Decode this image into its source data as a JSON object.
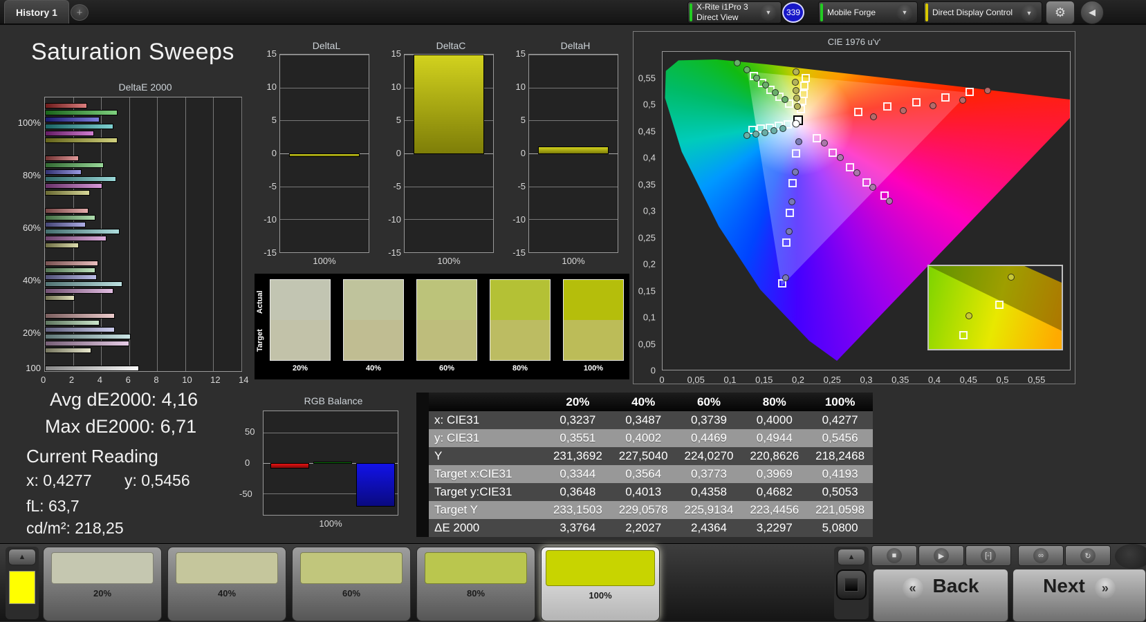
{
  "top_bar": {
    "tab": "History 1",
    "add_tab": "+",
    "meter": {
      "line1": "X-Rite i1Pro 3",
      "line2": "Direct View",
      "badge": "339",
      "status_color": "#22cc22"
    },
    "source": {
      "label": "Mobile Forge",
      "status_color": "#22cc22"
    },
    "workflow": {
      "label": "Direct Display Control",
      "status_color": "#d8c800"
    },
    "gear_icon": "⚙",
    "collapse_icon": "◀",
    "chevron_down": "▼"
  },
  "title": "Saturation Sweeps",
  "readings": {
    "avg": "Avg dE2000: 4,16",
    "max": "Max dE2000: 6,71",
    "heading": "Current Reading",
    "x": "x: 0,4277",
    "y": "y: 0,5456",
    "fl": "fL: 63,7",
    "cdm2": "cd/m²: 218,25"
  },
  "table": {
    "columns": [
      "20%",
      "40%",
      "60%",
      "80%",
      "100%"
    ],
    "rows": [
      {
        "label": "x: CIE31",
        "values": [
          "0,3237",
          "0,3487",
          "0,3739",
          "0,4000",
          "0,4277"
        ]
      },
      {
        "label": "y: CIE31",
        "values": [
          "0,3551",
          "0,4002",
          "0,4469",
          "0,4944",
          "0,5456"
        ]
      },
      {
        "label": "Y",
        "values": [
          "231,3692",
          "227,5040",
          "224,0270",
          "220,8626",
          "218,2468"
        ]
      },
      {
        "label": "Target x:CIE31",
        "values": [
          "0,3344",
          "0,3564",
          "0,3773",
          "0,3969",
          "0,4193"
        ]
      },
      {
        "label": "Target y:CIE31",
        "values": [
          "0,3648",
          "0,4013",
          "0,4358",
          "0,4682",
          "0,5053"
        ]
      },
      {
        "label": "Target Y",
        "values": [
          "233,1503",
          "229,0578",
          "225,9134",
          "223,4456",
          "221,0598"
        ]
      },
      {
        "label": "ΔE 2000",
        "values": [
          "3,3764",
          "2,2027",
          "2,4364",
          "3,2297",
          "5,0800"
        ]
      }
    ]
  },
  "bottom_bar": {
    "up_arrow": "▲",
    "current_color": "#ffff00",
    "patches": [
      {
        "label": "20%",
        "color": "#c5c7b0",
        "selected": false
      },
      {
        "label": "40%",
        "color": "#c5c69c",
        "selected": false
      },
      {
        "label": "60%",
        "color": "#c1c67c",
        "selected": false
      },
      {
        "label": "80%",
        "color": "#bac64e",
        "selected": false
      },
      {
        "label": "100%",
        "color": "#c8d400",
        "selected": true
      }
    ],
    "transport": [
      {
        "name": "stop-icon",
        "glyph": "■"
      },
      {
        "name": "play-icon",
        "glyph": "▶"
      },
      {
        "name": "measure-icon",
        "glyph": "[-]"
      },
      {
        "name": "loop-icon",
        "glyph": "∞"
      },
      {
        "name": "refresh-icon",
        "glyph": "↻"
      }
    ],
    "back_chev": "«",
    "back": "Back",
    "next": "Next",
    "next_chev": "»",
    "pattern_toggle_icon": "■"
  },
  "chart_data": [
    {
      "id": "deltae2000",
      "type": "bar",
      "orientation": "horizontal",
      "title": "DeltaE 2000",
      "xlim": [
        0,
        14
      ],
      "xticks": [
        0,
        2,
        4,
        6,
        8,
        10,
        12,
        14
      ],
      "series_order": [
        "red",
        "green",
        "blue",
        "cyan",
        "magenta",
        "yellow"
      ],
      "groups": [
        {
          "label": "100%",
          "values": [
            3.0,
            5.2,
            3.9,
            4.9,
            3.5,
            5.2
          ],
          "colors": [
            "#c62f2f",
            "#2fb42f",
            "#2f2fc6",
            "#2fb4b4",
            "#b42fb4",
            "#b4b42f"
          ]
        },
        {
          "label": "80%",
          "values": [
            2.4,
            4.2,
            2.6,
            5.1,
            4.1,
            3.2
          ],
          "colors": [
            "#cd5a5a",
            "#5abf5a",
            "#5a5acd",
            "#5abfbf",
            "#bf5abf",
            "#bfbf5a"
          ]
        },
        {
          "label": "60%",
          "values": [
            3.1,
            3.6,
            2.9,
            5.3,
            4.4,
            2.4
          ],
          "colors": [
            "#d47b7b",
            "#7bc77b",
            "#7b7bd4",
            "#7bc7c7",
            "#c77bc7",
            "#c7c77b"
          ]
        },
        {
          "label": "40%",
          "values": [
            3.8,
            3.6,
            3.7,
            5.5,
            4.9,
            2.1
          ],
          "colors": [
            "#da9494",
            "#94cf94",
            "#9494da",
            "#94cfcf",
            "#cf94cf",
            "#cfcf94"
          ]
        },
        {
          "label": "20%",
          "values": [
            5.0,
            3.9,
            5.0,
            6.1,
            6.0,
            3.3
          ],
          "colors": [
            "#e0acac",
            "#acd6ac",
            "#acace0",
            "#acd6d6",
            "#d6acd6",
            "#d6d6ac"
          ]
        },
        {
          "label": "100",
          "values": [
            6.71
          ],
          "colors": [
            "#f5f5f5"
          ]
        }
      ]
    },
    {
      "id": "deltaL",
      "type": "bar",
      "title": "DeltaL",
      "categories": [
        "100%"
      ],
      "ylim": [
        -15,
        15
      ],
      "yticks": [
        15,
        10,
        5,
        0,
        -5,
        -10,
        -15
      ],
      "values": [
        -0.4
      ]
    },
    {
      "id": "deltaC",
      "type": "bar",
      "title": "DeltaC",
      "categories": [
        "100%"
      ],
      "ylim": [
        -15,
        15
      ],
      "yticks": [
        15,
        10,
        5,
        0,
        -5,
        -10,
        -15
      ],
      "values": [
        15.2
      ],
      "clipped": true
    },
    {
      "id": "deltaH",
      "type": "bar",
      "title": "DeltaH",
      "categories": [
        "100%"
      ],
      "ylim": [
        -15,
        15
      ],
      "yticks": [
        15,
        10,
        5,
        0,
        -5,
        -10,
        -15
      ],
      "values": [
        1.0
      ]
    },
    {
      "id": "rgb_balance",
      "type": "bar",
      "title": "RGB Balance",
      "categories": [
        "100%"
      ],
      "ylim": [
        -85,
        85
      ],
      "yticks": [
        50,
        0,
        -50
      ],
      "series": [
        {
          "name": "Red",
          "value": -8,
          "color": "#e81212"
        },
        {
          "name": "Green",
          "value": 2,
          "color": "#0f9a0f"
        },
        {
          "name": "Blue",
          "value": -70,
          "color": "#1212e8"
        }
      ]
    },
    {
      "id": "cie1976",
      "type": "scatter",
      "title": "CIE 1976 u'v'",
      "xlim": [
        0,
        0.6
      ],
      "ylim": [
        0,
        0.6
      ],
      "xtick_labels": [
        "0",
        "0,05",
        "0,1",
        "0,15",
        "0,2",
        "0,25",
        "0,3",
        "0,35",
        "0,4",
        "0,45",
        "0,5",
        "0,55"
      ],
      "ytick_labels": [
        "0",
        "0,05",
        "0,1",
        "0,15",
        "0,2",
        "0,25",
        "0,3",
        "0,35",
        "0,4",
        "0,45",
        "0,5",
        "0,55"
      ],
      "tick_values": [
        0,
        0.05,
        0.1,
        0.15,
        0.2,
        0.25,
        0.3,
        0.35,
        0.4,
        0.45,
        0.5,
        0.55
      ],
      "white_point": {
        "square": [
          0.2,
          0.471
        ],
        "circle": [
          0.197,
          0.465
        ]
      },
      "chains": [
        {
          "name": "red",
          "color": "#b46a6a",
          "squares": [
            [
              0.288,
              0.487
            ],
            [
              0.331,
              0.497
            ],
            [
              0.374,
              0.505
            ],
            [
              0.417,
              0.514
            ],
            [
              0.452,
              0.524
            ]
          ],
          "circles": [
            [
              0.311,
              0.477
            ],
            [
              0.354,
              0.489
            ],
            [
              0.398,
              0.498
            ],
            [
              0.442,
              0.509
            ],
            [
              0.479,
              0.527
            ]
          ]
        },
        {
          "name": "green",
          "color": "#6aae6a",
          "squares": [
            [
              0.186,
              0.502
            ],
            [
              0.172,
              0.515
            ],
            [
              0.159,
              0.528
            ],
            [
              0.147,
              0.541
            ],
            [
              0.134,
              0.554
            ]
          ],
          "circles": [
            [
              0.18,
              0.51
            ],
            [
              0.166,
              0.523
            ],
            [
              0.152,
              0.537
            ],
            [
              0.139,
              0.551
            ],
            [
              0.124,
              0.566
            ],
            [
              0.11,
              0.579
            ]
          ]
        },
        {
          "name": "blue",
          "color": "#7a7ab4",
          "squares": [
            [
              0.197,
              0.408
            ],
            [
              0.192,
              0.352
            ],
            [
              0.187,
              0.296
            ],
            [
              0.182,
              0.24
            ],
            [
              0.176,
              0.163
            ]
          ],
          "circles": [
            [
              0.201,
              0.43
            ],
            [
              0.196,
              0.373
            ],
            [
              0.191,
              0.317
            ],
            [
              0.186,
              0.261
            ],
            [
              0.181,
              0.173
            ]
          ]
        },
        {
          "name": "cyan",
          "color": "#6aaea6",
          "squares": [
            [
              0.184,
              0.463
            ],
            [
              0.171,
              0.46
            ],
            [
              0.158,
              0.457
            ],
            [
              0.145,
              0.455
            ],
            [
              0.132,
              0.452
            ]
          ],
          "circles": [
            [
              0.177,
              0.455
            ],
            [
              0.164,
              0.451
            ],
            [
              0.151,
              0.448
            ],
            [
              0.138,
              0.445
            ],
            [
              0.124,
              0.442
            ]
          ]
        },
        {
          "name": "magenta",
          "color": "#aa78aa",
          "squares": [
            [
              0.227,
              0.437
            ],
            [
              0.251,
              0.41
            ],
            [
              0.276,
              0.382
            ],
            [
              0.3,
              0.354
            ],
            [
              0.327,
              0.329
            ]
          ],
          "circles": [
            [
              0.238,
              0.428
            ],
            [
              0.262,
              0.4
            ],
            [
              0.286,
              0.372
            ],
            [
              0.31,
              0.345
            ],
            [
              0.334,
              0.318
            ]
          ]
        },
        {
          "name": "yellow",
          "color": "#b4b45a",
          "squares": [
            [
              0.204,
              0.492
            ],
            [
              0.206,
              0.507
            ],
            [
              0.208,
              0.521
            ],
            [
              0.209,
              0.536
            ],
            [
              0.211,
              0.551
            ]
          ],
          "circles": [
            [
              0.199,
              0.497
            ],
            [
              0.198,
              0.512
            ],
            [
              0.197,
              0.527
            ],
            [
              0.196,
              0.542
            ],
            [
              0.197,
              0.562
            ]
          ]
        }
      ],
      "inset": {
        "circles": [
          [
            62,
            13
          ],
          [
            30,
            60
          ]
        ],
        "squares": [
          [
            53,
            47
          ],
          [
            26,
            83
          ]
        ]
      }
    },
    {
      "id": "saturation_swatches",
      "type": "table",
      "row_labels": [
        "Actual",
        "Target"
      ],
      "labels": [
        "20%",
        "40%",
        "60%",
        "80%",
        "100%"
      ],
      "actual": [
        "#c2c5b2",
        "#bfc39c",
        "#bcc37a",
        "#b4c135",
        "#b5be0b"
      ],
      "target": [
        "#c2c2a9",
        "#c0bd92",
        "#bebd7c",
        "#bcbc62",
        "#bcbc58"
      ]
    }
  ]
}
